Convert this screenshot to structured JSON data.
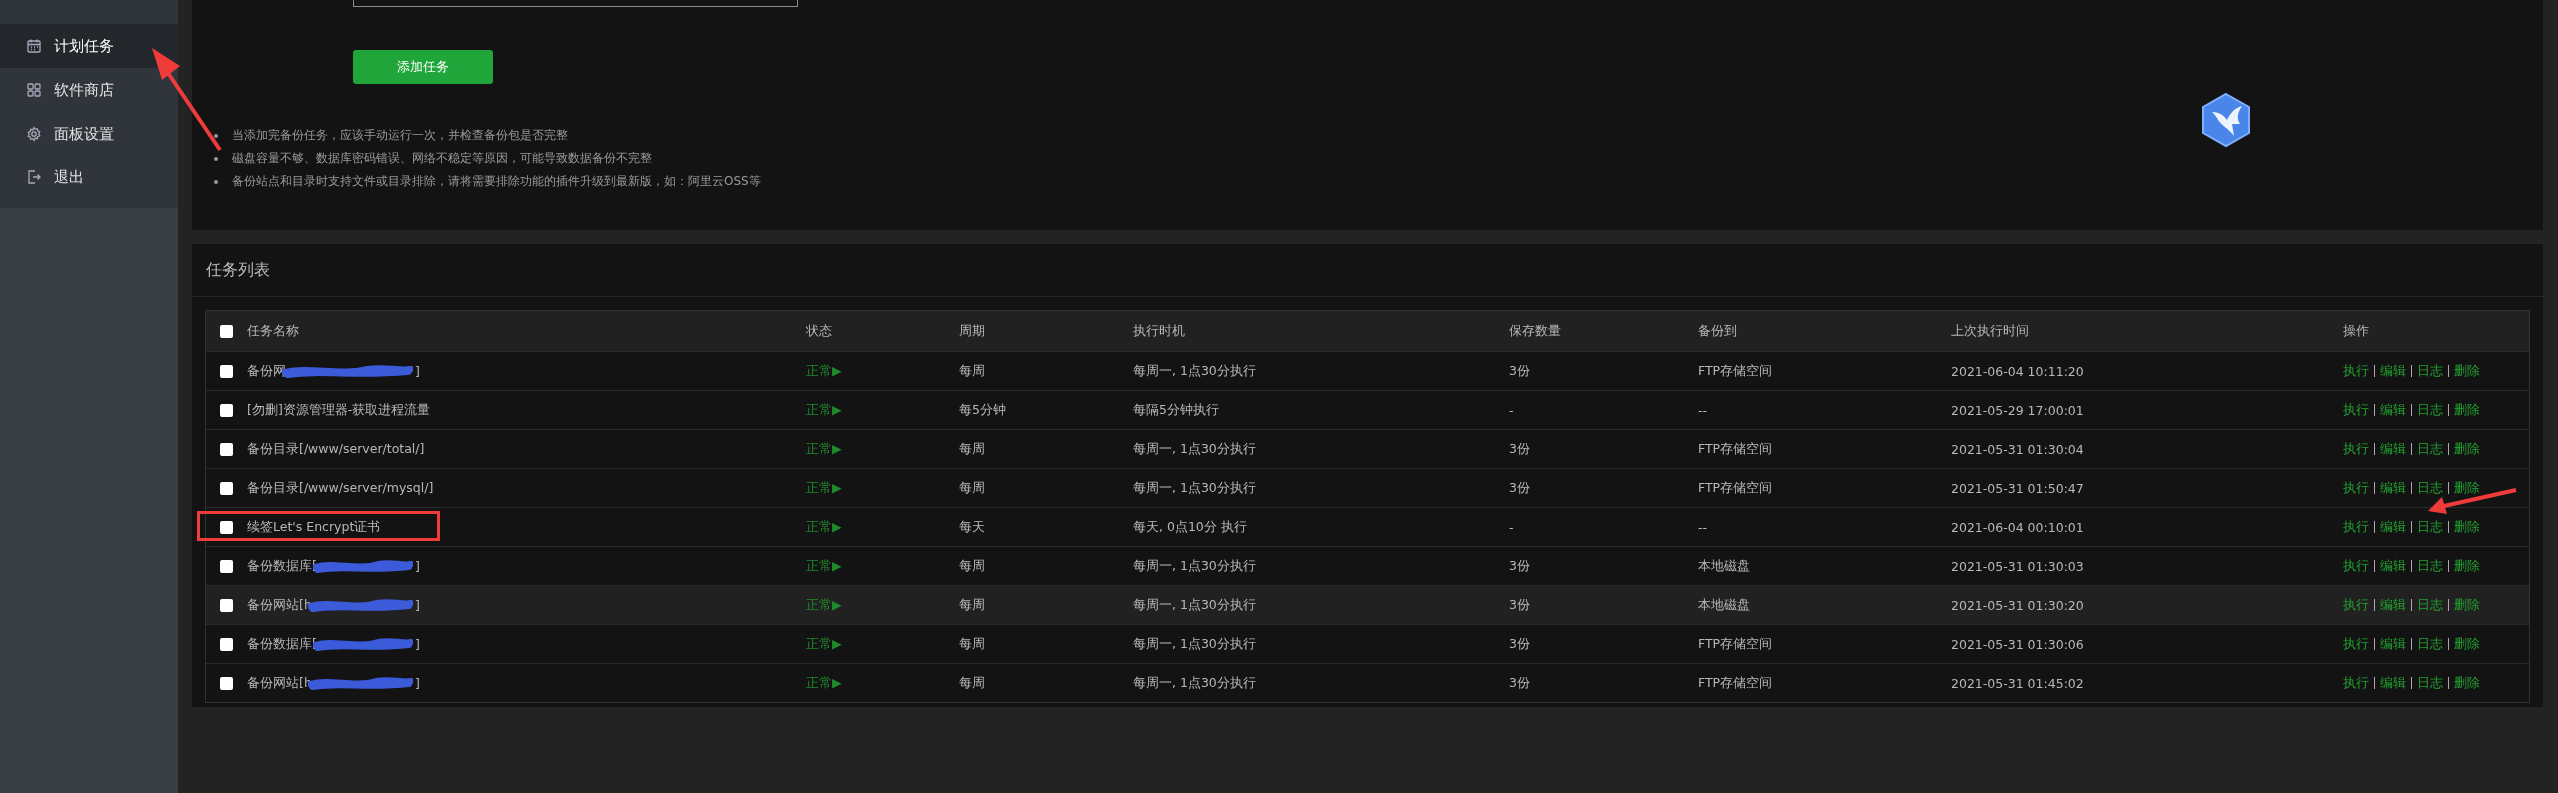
{
  "sidebar": {
    "items": [
      {
        "label": "计划任务",
        "selected": true
      },
      {
        "label": "软件商店",
        "selected": false
      },
      {
        "label": "面板设置",
        "selected": false
      },
      {
        "label": "退出",
        "selected": false
      }
    ]
  },
  "task_form": {
    "add_button": "添加任务",
    "notes": [
      "当添加完备份任务，应该手动运行一次，并检查备份包是否完整",
      "磁盘容量不够、数据库密码错误、网络不稳定等原因，可能导致数据备份不完整",
      "备份站点和目录时支持文件或目录排除，请将需要排除功能的插件升级到最新版，如：阿里云OSS等"
    ]
  },
  "task_list": {
    "title": "任务列表",
    "columns": [
      "任务名称",
      "状态",
      "周期",
      "执行时机",
      "保存数量",
      "备份到",
      "上次执行时间",
      "操作"
    ],
    "header_checked": false,
    "rows": [
      {
        "checked": false,
        "highlighted": false,
        "framed": false,
        "name": "备份网",
        "redacted": true,
        "tail": "]",
        "status": "正常▶",
        "cycle": "每周",
        "timing": "每周一, 1点30分执行",
        "keep": "3份",
        "target": "FTP存储空间",
        "last_run": "2021-06-04 10:11:20",
        "actions": [
          "执行",
          "编辑",
          "日志",
          "删除"
        ]
      },
      {
        "checked": false,
        "highlighted": false,
        "framed": false,
        "name": "[勿删]资源管理器-获取进程流量",
        "redacted": false,
        "status": "正常▶",
        "cycle": "每5分钟",
        "timing": "每隔5分钟执行",
        "keep": "-",
        "target": "--",
        "last_run": "2021-05-29 17:00:01",
        "actions": [
          "执行",
          "编辑",
          "日志",
          "删除"
        ]
      },
      {
        "checked": false,
        "highlighted": false,
        "framed": false,
        "name": "备份目录[/www/server/total/]",
        "redacted": false,
        "status": "正常▶",
        "cycle": "每周",
        "timing": "每周一, 1点30分执行",
        "keep": "3份",
        "target": "FTP存储空间",
        "last_run": "2021-05-31 01:30:04",
        "actions": [
          "执行",
          "编辑",
          "日志",
          "删除"
        ]
      },
      {
        "checked": false,
        "highlighted": false,
        "framed": false,
        "name": "备份目录[/www/server/mysql/]",
        "redacted": false,
        "status": "正常▶",
        "cycle": "每周",
        "timing": "每周一, 1点30分执行",
        "keep": "3份",
        "target": "FTP存储空间",
        "last_run": "2021-05-31 01:50:47",
        "actions": [
          "执行",
          "编辑",
          "日志",
          "删除"
        ]
      },
      {
        "checked": false,
        "highlighted": false,
        "framed": true,
        "name": "续签Let's Encrypt证书",
        "redacted": false,
        "status": "正常▶",
        "cycle": "每天",
        "timing": "每天, 0点10分 执行",
        "keep": "-",
        "target": "--",
        "last_run": "2021-06-04 00:10:01",
        "actions": [
          "执行",
          "编辑",
          "日志",
          "删除"
        ]
      },
      {
        "checked": false,
        "highlighted": false,
        "framed": false,
        "name": "备份数据库[",
        "redacted": true,
        "tail": "]",
        "status": "正常▶",
        "cycle": "每周",
        "timing": "每周一, 1点30分执行",
        "keep": "3份",
        "target": "本地磁盘",
        "last_run": "2021-05-31 01:30:03",
        "actions": [
          "执行",
          "编辑",
          "日志",
          "删除"
        ]
      },
      {
        "checked": false,
        "highlighted": true,
        "framed": false,
        "name": "备份网站[h",
        "redacted": true,
        "tail": "]",
        "status": "正常▶",
        "cycle": "每周",
        "timing": "每周一, 1点30分执行",
        "keep": "3份",
        "target": "本地磁盘",
        "last_run": "2021-05-31 01:30:20",
        "actions": [
          "执行",
          "编辑",
          "日志",
          "删除"
        ]
      },
      {
        "checked": false,
        "highlighted": false,
        "framed": false,
        "name": "备份数据库[",
        "redacted": true,
        "tail": "]",
        "status": "正常▶",
        "cycle": "每周",
        "timing": "每周一, 1点30分执行",
        "keep": "3份",
        "target": "FTP存储空间",
        "last_run": "2021-05-31 01:30:06",
        "actions": [
          "执行",
          "编辑",
          "日志",
          "删除"
        ]
      },
      {
        "checked": false,
        "highlighted": false,
        "framed": false,
        "name": "备份网站[h",
        "redacted": true,
        "tail": "]",
        "status": "正常▶",
        "cycle": "每周",
        "timing": "每周一, 1点30分执行",
        "keep": "3份",
        "target": "FTP存储空间",
        "last_run": "2021-05-31 01:45:02",
        "actions": [
          "执行",
          "编辑",
          "日志",
          "删除"
        ]
      }
    ]
  },
  "annotations": [
    {
      "kind": "arrow"
    },
    {
      "kind": "arrow"
    }
  ]
}
